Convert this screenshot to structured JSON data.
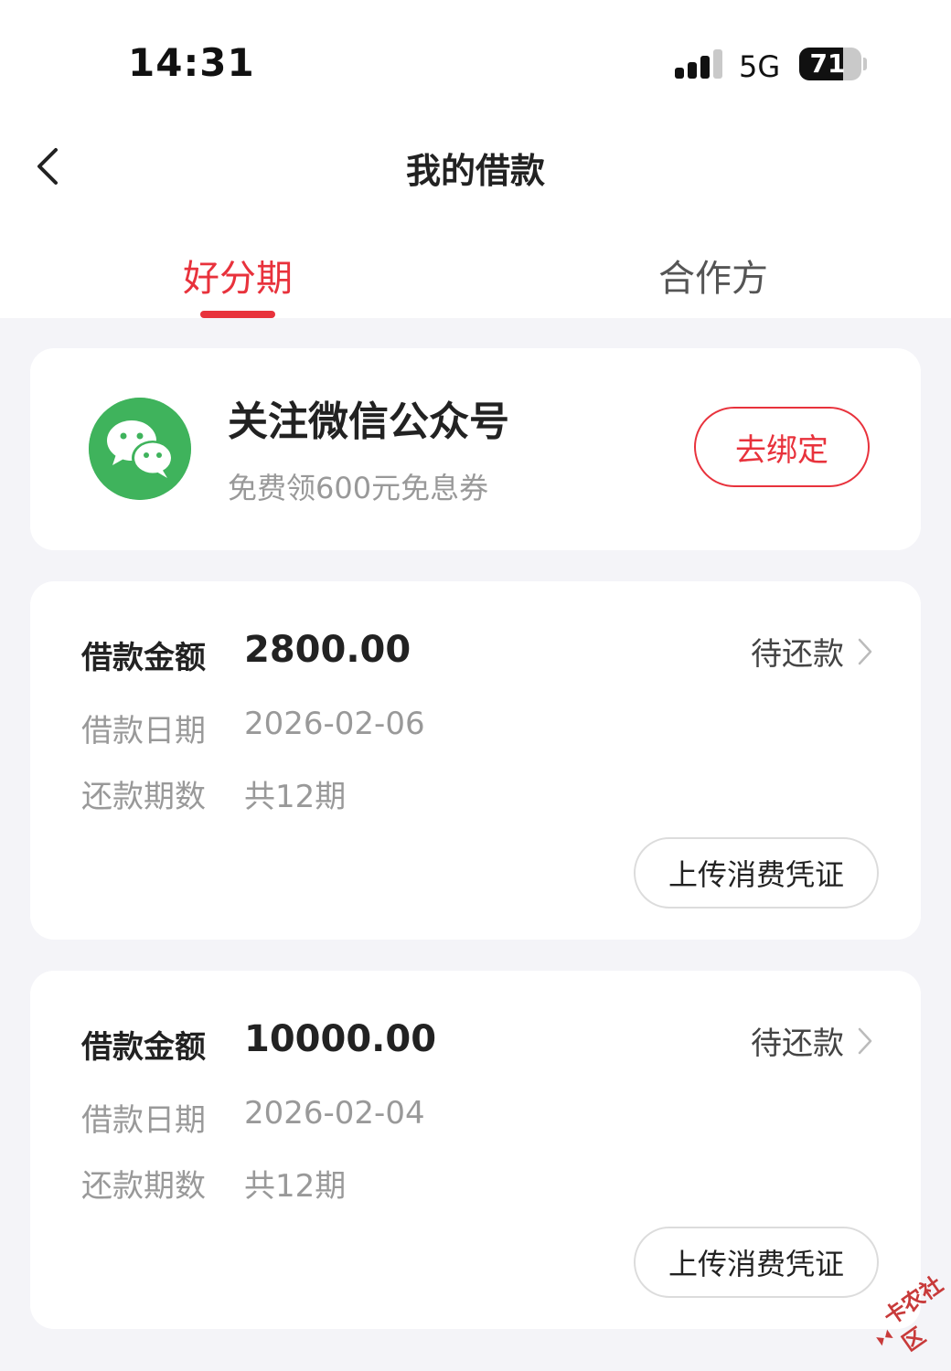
{
  "status_bar": {
    "time": "14:31",
    "network": "5G",
    "battery": "71",
    "battery_level": 0.71,
    "icons": [
      "signal-icon",
      "battery-icon"
    ]
  },
  "nav": {
    "title": "我的借款",
    "back_icon": "chevron-left-icon"
  },
  "tabs": [
    {
      "label": "好分期",
      "active": true
    },
    {
      "label": "合作方",
      "active": false
    }
  ],
  "promo": {
    "icon": "wechat-icon",
    "title": "关注微信公众号",
    "subtitle": "免费领600元免息券",
    "button": "去绑定"
  },
  "loans": [
    {
      "amount_label": "借款金额",
      "amount": "2800.00",
      "status": "待还款",
      "date_label": "借款日期",
      "date": "2026-02-06",
      "term_label": "还款期数",
      "term": "共12期",
      "upload_button": "上传消费凭证"
    },
    {
      "amount_label": "借款金额",
      "amount": "10000.00",
      "status": "待还款",
      "date_label": "借款日期",
      "date": "2026-02-04",
      "term_label": "还款期数",
      "term": "共12期",
      "upload_button": "上传消费凭证"
    }
  ],
  "watermark": "卡农社区",
  "colors": {
    "accent": "#e8323c",
    "wechat_green": "#3fb35c",
    "background": "#f4f4f8"
  }
}
